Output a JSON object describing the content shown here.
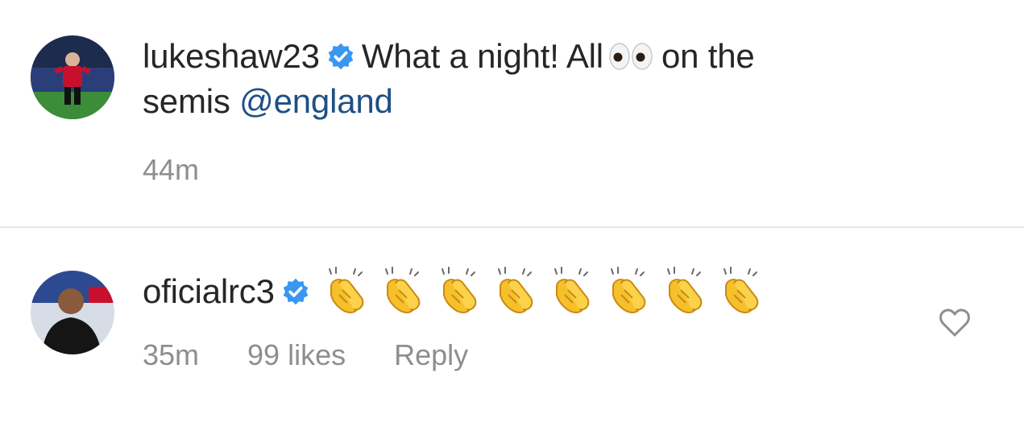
{
  "post": {
    "username": "lukeshaw23",
    "caption_before": "What a night! All",
    "emoji": "eyes",
    "caption_after": "on the",
    "caption_line2": "semis",
    "mention": "@england",
    "time": "44m"
  },
  "comment": {
    "username": "oficialrc3",
    "emoji": "clapping-hands",
    "emoji_count": 8,
    "time": "35m",
    "likes": "99 likes",
    "reply": "Reply"
  },
  "colors": {
    "text": "#262626",
    "secondary": "#8e8e8e",
    "verified": "#3897f0",
    "mention": "#1f4f84",
    "divider": "#e6e6e6"
  }
}
